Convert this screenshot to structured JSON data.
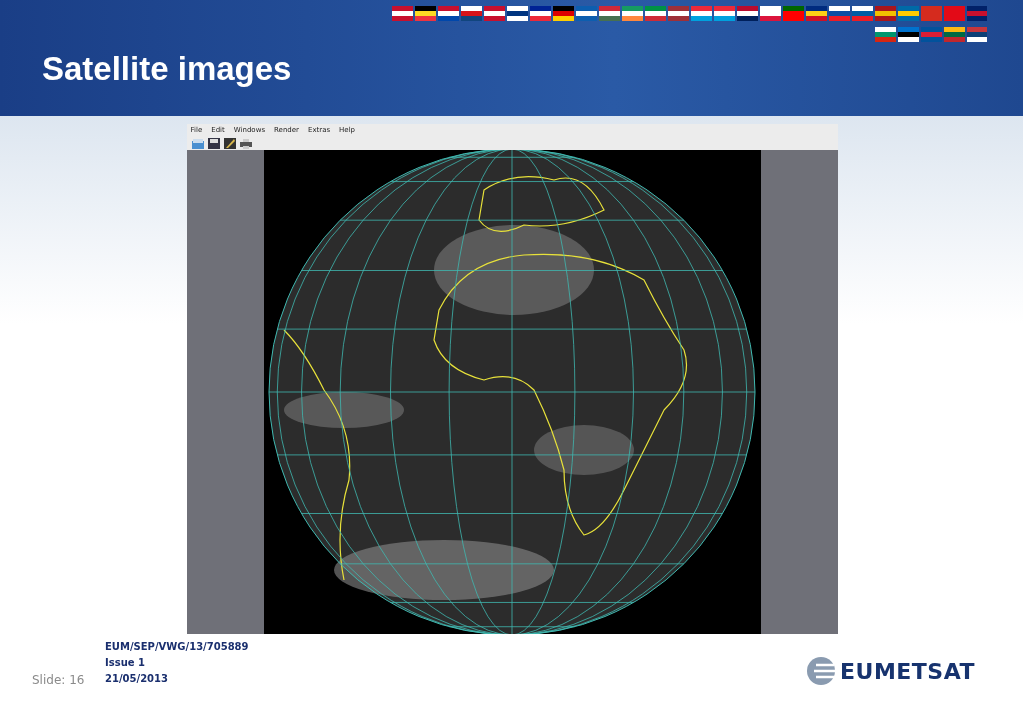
{
  "slide": {
    "title": "Satellite images"
  },
  "app_window": {
    "menu": [
      "File",
      "Edit",
      "Windows",
      "Render",
      "Extras",
      "Help"
    ]
  },
  "footer": {
    "document_id": "EUM/SEP/VWG/13/705889",
    "issue": "Issue 1",
    "date": "21/05/2013",
    "slide_number": "Slide: 16",
    "logo_text": "EUMETSAT"
  }
}
